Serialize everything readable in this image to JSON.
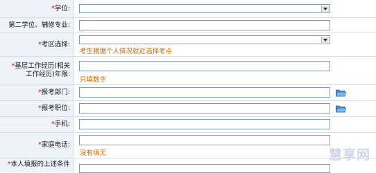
{
  "form": {
    "rows": [
      {
        "label": "学位:"
      },
      {
        "label": "第二学位、辅修专业:"
      },
      {
        "label": "考区选择:",
        "hint": "考生根据个人情况就近选择考点"
      },
      {
        "label": "基层工作经历(相关工作经历)年限:",
        "hint": "只填数字"
      },
      {
        "label": "报考部门:"
      },
      {
        "label": "报考职位:"
      },
      {
        "label": "手机:"
      },
      {
        "label": "家庭电话:",
        "hint": "没有填无"
      },
      {
        "label": "本人填报的上述条件"
      }
    ],
    "required_mark": "*"
  },
  "icons": {
    "dropdown_arrow": "chevron-down-icon",
    "browse": "folder-icon"
  },
  "watermark": {
    "text": "慧享网"
  },
  "colors": {
    "label_bg": "#eef2f9",
    "hint": "#c66a00",
    "required": "#d40000",
    "border": "#7f9db9"
  }
}
